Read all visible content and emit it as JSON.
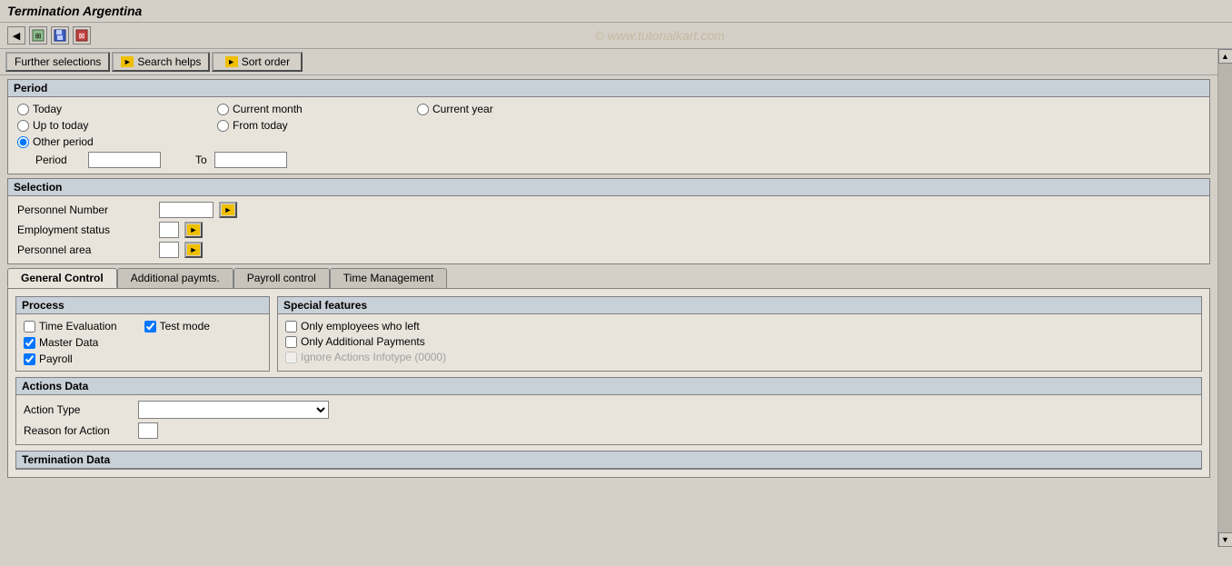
{
  "titleBar": {
    "title": "Termination Argentina"
  },
  "toolbar": {
    "icons": [
      "back-icon",
      "forward-icon",
      "save-icon",
      "find-icon"
    ],
    "watermark": "© www.tutorialkart.com"
  },
  "topNav": {
    "tabs": [
      {
        "id": "further-selections",
        "label": "Further selections",
        "active": false
      },
      {
        "id": "search-helps",
        "label": "Search helps",
        "active": false
      },
      {
        "id": "sort-order",
        "label": "Sort order",
        "active": false
      }
    ]
  },
  "periodSection": {
    "title": "Period",
    "options": [
      {
        "id": "today",
        "label": "Today",
        "checked": false
      },
      {
        "id": "current-month",
        "label": "Current month",
        "checked": false
      },
      {
        "id": "current-year",
        "label": "Current year",
        "checked": false
      },
      {
        "id": "up-to-today",
        "label": "Up to today",
        "checked": false
      },
      {
        "id": "from-today",
        "label": "From today",
        "checked": false
      },
      {
        "id": "other-period",
        "label": "Other period",
        "checked": true
      }
    ],
    "periodLabel": "Period",
    "toLabel": "To",
    "periodValue": "",
    "toValue": ""
  },
  "selectionSection": {
    "title": "Selection",
    "fields": [
      {
        "label": "Personnel Number",
        "value": "",
        "width": "wide"
      },
      {
        "label": "Employment status",
        "value": "",
        "width": "small"
      },
      {
        "label": "Personnel area",
        "value": "",
        "width": "small"
      }
    ]
  },
  "tabs": {
    "items": [
      {
        "id": "general-control",
        "label": "General Control",
        "active": true
      },
      {
        "id": "additional-paymts",
        "label": "Additional paymts.",
        "active": false
      },
      {
        "id": "payroll-control",
        "label": "Payroll control",
        "active": false
      },
      {
        "id": "time-management",
        "label": "Time Management",
        "active": false
      }
    ]
  },
  "processSection": {
    "title": "Process",
    "items": [
      {
        "id": "time-evaluation",
        "label": "Time Evaluation",
        "checked": false
      },
      {
        "id": "master-data",
        "label": "Master Data",
        "checked": true
      },
      {
        "id": "payroll",
        "label": "Payroll",
        "checked": true
      }
    ]
  },
  "testModeSection": {
    "items": [
      {
        "id": "test-mode",
        "label": "Test mode",
        "checked": true
      }
    ]
  },
  "specialFeaturesSection": {
    "title": "Special features",
    "items": [
      {
        "id": "only-employees-who-left",
        "label": "Only employees who left",
        "checked": false,
        "disabled": false
      },
      {
        "id": "only-additional-payments",
        "label": "Only Additional Payments",
        "checked": false,
        "disabled": false
      },
      {
        "id": "ignore-actions-infotype",
        "label": "Ignore Actions Infotype (0000)",
        "checked": false,
        "disabled": true
      }
    ]
  },
  "actionsDataSection": {
    "title": "Actions Data",
    "fields": [
      {
        "id": "action-type",
        "label": "Action Type",
        "type": "dropdown",
        "value": ""
      },
      {
        "id": "reason-for-action",
        "label": "Reason for Action",
        "type": "input-small",
        "value": ""
      }
    ]
  },
  "terminationDataSection": {
    "title": "Termination Data"
  },
  "scrollbar": {
    "upArrow": "▲",
    "downArrow": "▼"
  }
}
